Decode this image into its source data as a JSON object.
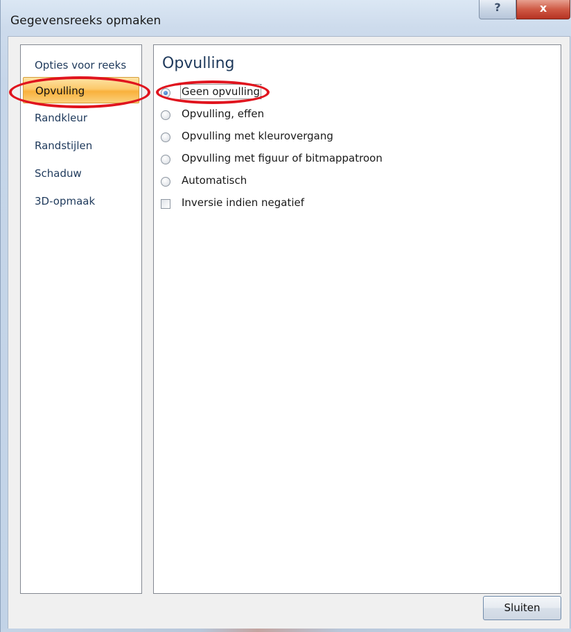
{
  "window": {
    "title": "Gegevensreeks opmaken",
    "help_icon": "?",
    "close_icon": "x"
  },
  "sidebar": {
    "items": [
      {
        "label": "Opties voor reeks",
        "selected": false
      },
      {
        "label": "Opvulling",
        "selected": true
      },
      {
        "label": "Randkleur",
        "selected": false
      },
      {
        "label": "Randstijlen",
        "selected": false
      },
      {
        "label": "Schaduw",
        "selected": false
      },
      {
        "label": "3D-opmaak",
        "selected": false
      }
    ]
  },
  "panel": {
    "title": "Opvulling",
    "options": [
      {
        "label": "Geen opvulling",
        "type": "radio",
        "checked": true
      },
      {
        "label": "Opvulling, effen",
        "type": "radio",
        "checked": false
      },
      {
        "label": "Opvulling met kleurovergang",
        "type": "radio",
        "checked": false
      },
      {
        "label": "Opvulling met figuur of bitmappatroon",
        "type": "radio",
        "checked": false
      },
      {
        "label": "Automatisch",
        "type": "radio",
        "checked": false
      },
      {
        "label": "Inversie indien negatief",
        "type": "checkbox",
        "checked": false
      }
    ]
  },
  "footer": {
    "close_label": "Sluiten"
  },
  "colors": {
    "accent_selected": "#f9b03c",
    "annotation": "#e0141e",
    "radio_dot": "#1f63b8"
  }
}
